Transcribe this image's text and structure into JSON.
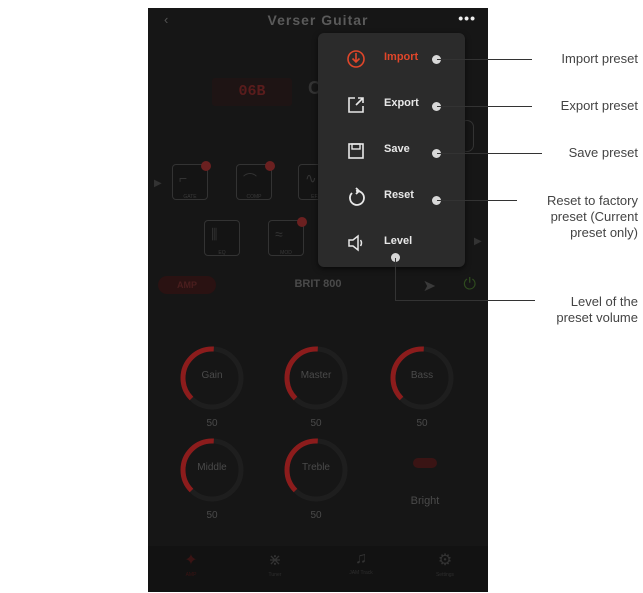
{
  "app": {
    "title": "Verser Guitar",
    "back_icon": "‹",
    "more_icon": "•••",
    "preset_number": "06B",
    "preset_name": "C",
    "amp_tag": "AMP",
    "amp_name": "BRIT 800"
  },
  "chain": {
    "row1": [
      {
        "label": "GATE"
      },
      {
        "label": "COMP"
      },
      {
        "label": "EFX"
      }
    ],
    "row2": [
      {
        "label": "EQ"
      },
      {
        "label": "MOD"
      }
    ]
  },
  "knobs": [
    {
      "label": "Gain",
      "value": "50"
    },
    {
      "label": "Master",
      "value": "50"
    },
    {
      "label": "Bass",
      "value": "50"
    },
    {
      "label": "Middle",
      "value": "50"
    },
    {
      "label": "Treble",
      "value": "50"
    }
  ],
  "bright_label": "Bright",
  "nav": [
    {
      "label": "AMP"
    },
    {
      "label": "Tuner"
    },
    {
      "label": "JAM Track"
    },
    {
      "label": "Settings"
    }
  ],
  "menu": {
    "items": [
      {
        "label": "Import",
        "icon": "import-icon",
        "active": true
      },
      {
        "label": "Export",
        "icon": "export-icon"
      },
      {
        "label": "Save",
        "icon": "save-icon"
      },
      {
        "label": "Reset",
        "icon": "reset-icon"
      },
      {
        "label": "Level",
        "icon": "volume-icon"
      }
    ]
  },
  "callouts": {
    "import": "Import preset",
    "export": "Export preset",
    "save": "Save preset",
    "reset_line1": "Reset to factory",
    "reset_line2": "preset (Current",
    "reset_line3": "preset only)",
    "level_line1": "Level of the",
    "level_line2": "preset volume"
  },
  "colors": {
    "accent": "#e0462a",
    "knob_arc": "#8c1c1c",
    "menu_bg": "#2b2b2b",
    "app_bg": "#161616"
  }
}
